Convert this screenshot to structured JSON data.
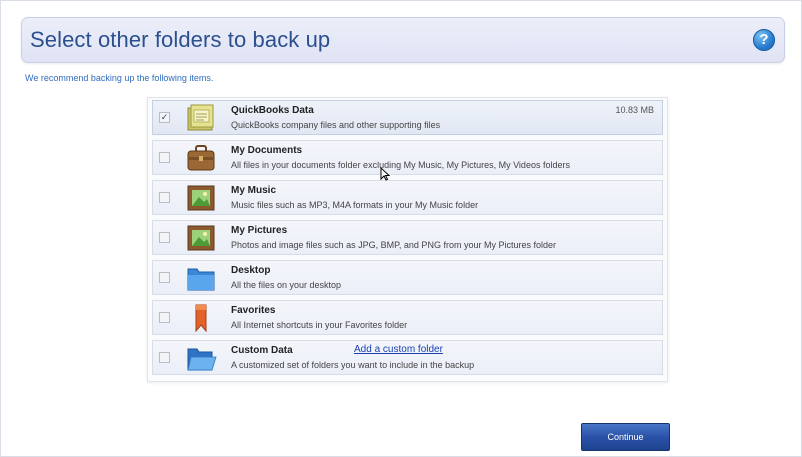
{
  "header": {
    "title": "Select other folders to back up",
    "help_icon": "help-question-icon",
    "help_glyph": "?"
  },
  "recommend_text": "We recommend backing up the following items.",
  "items": [
    {
      "title": "QuickBooks Data",
      "description": "QuickBooks company files and other supporting files",
      "size": "10.83 MB",
      "checked": true,
      "check_glyph": "✓",
      "icon": "quickbooks-data-icon"
    },
    {
      "title": "My Documents",
      "description": "All files in your documents folder excluding My Music, My Pictures, My Videos folders",
      "checked": false,
      "icon": "briefcase-icon"
    },
    {
      "title": "My Music",
      "description": "Music files such as MP3, M4A formats in your My Music folder",
      "checked": false,
      "icon": "picture-frame-icon"
    },
    {
      "title": "My Pictures",
      "description": "Photos and image files such as JPG, BMP, and PNG from your My Pictures folder",
      "checked": false,
      "icon": "picture-frame-icon"
    },
    {
      "title": "Desktop",
      "description": "All the files on your desktop",
      "checked": false,
      "icon": "blue-folder-icon"
    },
    {
      "title": "Favorites",
      "description": "All Internet shortcuts in your Favorites folder",
      "checked": false,
      "icon": "ribbon-bookmark-icon"
    },
    {
      "title": "Custom Data",
      "description": "A customized set of folders you want to include in the backup",
      "link": "Add a custom folder",
      "checked": false,
      "icon": "open-folder-icon"
    }
  ],
  "continue_label": "Continue",
  "colors": {
    "title": "#2b4f8f",
    "accent": "#2f6bbd",
    "link": "#1a3fb5",
    "button": "#2a52a8"
  }
}
